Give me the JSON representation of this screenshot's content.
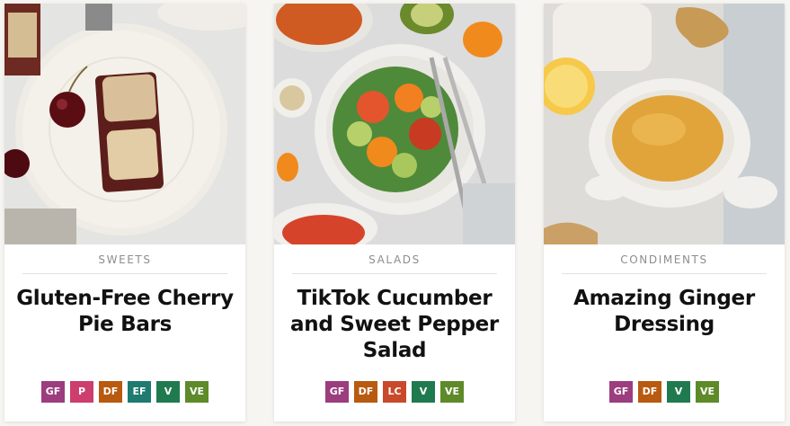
{
  "badge_colors": {
    "GF": "#9b3d7e",
    "P": "#cc3e6e",
    "DF": "#b85a10",
    "EF": "#1f7a6f",
    "V": "#207a50",
    "VE": "#5e8a2a",
    "LC": "#c94a2b"
  },
  "cards": [
    {
      "category": "SWEETS",
      "title": "Gluten-Free Cherry Pie Bars",
      "image_icon": "cherry-pie-bars-image",
      "badges": [
        "GF",
        "P",
        "DF",
        "EF",
        "V",
        "VE"
      ]
    },
    {
      "category": "SALADS",
      "title": "TikTok Cucumber and Sweet Pepper Salad",
      "image_icon": "cucumber-pepper-salad-image",
      "badges": [
        "GF",
        "DF",
        "LC",
        "V",
        "VE"
      ]
    },
    {
      "category": "CONDIMENTS",
      "title": "Amazing Ginger Dressing",
      "image_icon": "ginger-dressing-image",
      "badges": [
        "GF",
        "DF",
        "V",
        "VE"
      ]
    }
  ]
}
